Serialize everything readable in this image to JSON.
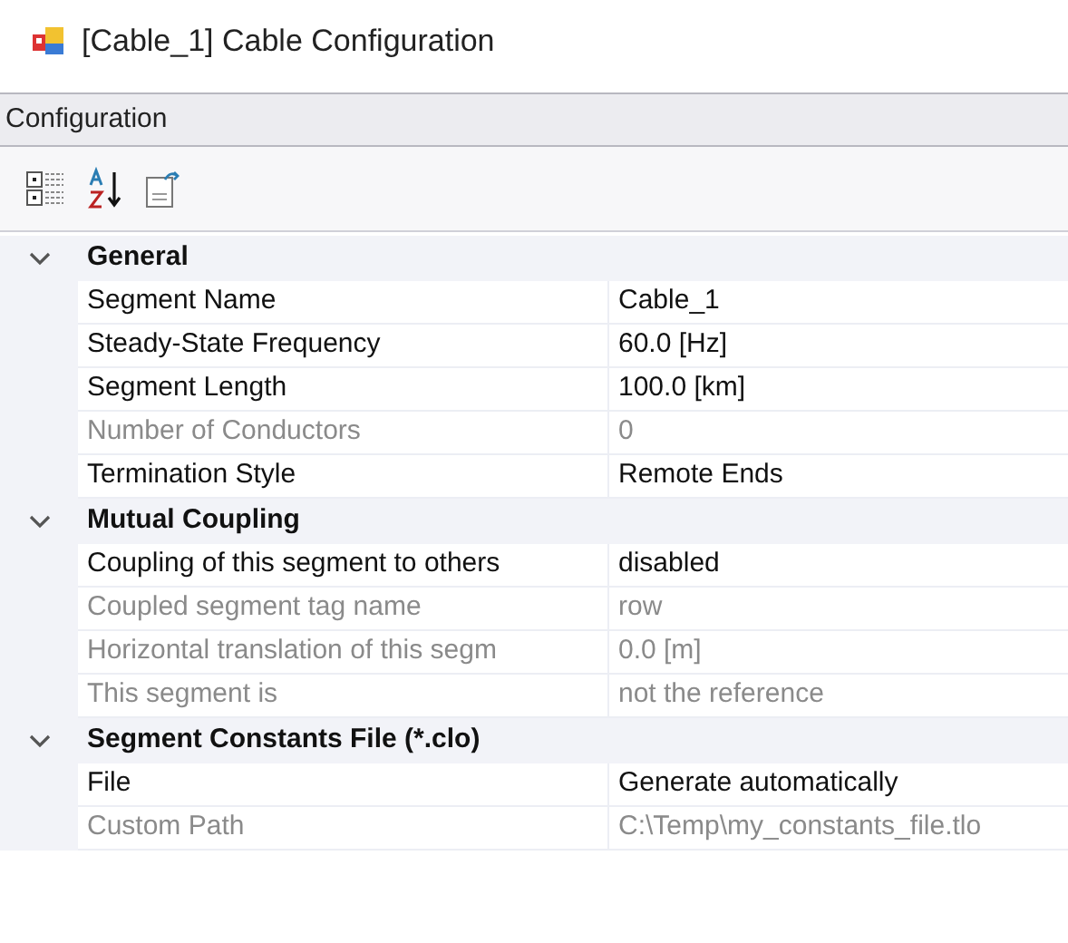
{
  "window": {
    "title": "[Cable_1] Cable Configuration"
  },
  "panel": {
    "header": "Configuration"
  },
  "toolbar": {
    "buttons": [
      {
        "kind": "categorized"
      },
      {
        "kind": "alphabetical"
      },
      {
        "kind": "pages"
      }
    ]
  },
  "categories": [
    {
      "name": "General",
      "expanded": true,
      "properties": [
        {
          "name": "Segment Name",
          "value": "Cable_1",
          "disabled": false
        },
        {
          "name": "Steady-State Frequency",
          "value": "60.0 [Hz]",
          "disabled": false
        },
        {
          "name": "Segment Length",
          "value": "100.0 [km]",
          "disabled": false
        },
        {
          "name": "Number of Conductors",
          "value": "0",
          "disabled": true
        },
        {
          "name": "Termination Style",
          "value": "Remote Ends",
          "disabled": false
        }
      ]
    },
    {
      "name": "Mutual Coupling",
      "expanded": true,
      "properties": [
        {
          "name": "Coupling of this segment to others",
          "value": "disabled",
          "disabled": false
        },
        {
          "name": "Coupled segment tag name",
          "value": "row",
          "disabled": true
        },
        {
          "name": "Horizontal translation of this segm",
          "value": "0.0 [m]",
          "disabled": true
        },
        {
          "name": "This segment is",
          "value": "not the reference",
          "disabled": true
        }
      ]
    },
    {
      "name": "Segment Constants File (*.clo)",
      "expanded": true,
      "properties": [
        {
          "name": "File",
          "value": "Generate automatically",
          "disabled": false
        },
        {
          "name": "Custom Path",
          "value": "C:\\Temp\\my_constants_file.tlo",
          "disabled": true
        }
      ]
    }
  ]
}
